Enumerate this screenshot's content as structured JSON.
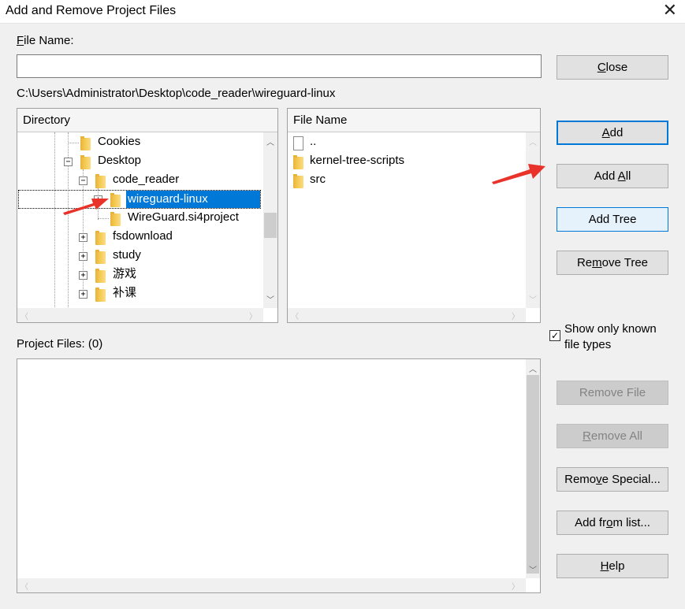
{
  "window": {
    "title": "Add and Remove Project Files"
  },
  "file_name": {
    "label": "File Name:",
    "value": ""
  },
  "current_path": "C:\\Users\\Administrator\\Desktop\\code_reader\\wireguard-linux",
  "directory": {
    "header": "Directory",
    "items": [
      {
        "label": "Cookies"
      },
      {
        "label": "Desktop"
      },
      {
        "label": "code_reader"
      },
      {
        "label": "wireguard-linux"
      },
      {
        "label": "WireGuard.si4project"
      },
      {
        "label": "fsdownload"
      },
      {
        "label": "study"
      },
      {
        "label": "游戏"
      },
      {
        "label": "补课"
      }
    ]
  },
  "file_list": {
    "header": "File Name",
    "items": [
      {
        "label": "..",
        "icon": "file-icon"
      },
      {
        "label": "kernel-tree-scripts",
        "icon": "folder-icon"
      },
      {
        "label": "src",
        "icon": "folder-icon"
      }
    ]
  },
  "project_files": {
    "label": "Project Files: (0)"
  },
  "show_known": {
    "line1": "Show only known",
    "line2": "file types",
    "checked": "✓"
  },
  "buttons": {
    "close": {
      "pre": "",
      "key": "C",
      "post": "lose"
    },
    "add": {
      "pre": "",
      "key": "A",
      "post": "dd"
    },
    "add_all": {
      "pre": "Add ",
      "key": "A",
      "post": "ll"
    },
    "add_tree": {
      "label": "Add Tree"
    },
    "remove_tree": {
      "pre": "Re",
      "key": "m",
      "post": "ove Tree"
    },
    "remove_file": {
      "label": "Remove File"
    },
    "remove_all": {
      "pre": "",
      "key": "R",
      "post": "emove All"
    },
    "remove_special": {
      "pre": "Remo",
      "key": "v",
      "post": "e Special..."
    },
    "add_from_list": {
      "pre": "Add fr",
      "key": "o",
      "post": "m list..."
    },
    "help": {
      "pre": "",
      "key": "H",
      "post": "elp"
    }
  },
  "colors": {
    "selection": "#0078d7",
    "annotation_arrow": "#e8322a"
  }
}
